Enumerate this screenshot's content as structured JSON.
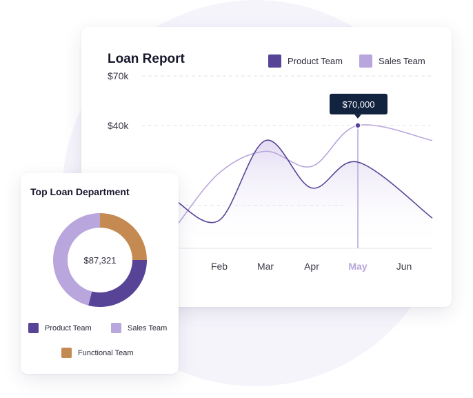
{
  "colors": {
    "product": "#584497",
    "sales": "#b9a6dc",
    "functional": "#c48a52",
    "tooltip_bg": "#12233f"
  },
  "report": {
    "title": "Loan Report",
    "legend": [
      {
        "label": "Product Team",
        "color": "#584497"
      },
      {
        "label": "Sales Team",
        "color": "#b9a6dc"
      }
    ],
    "tooltip": "$70,000",
    "active_month": "May"
  },
  "department": {
    "title": "Top Loan Department",
    "total": "$87,321",
    "legend": [
      {
        "label": "Product Team",
        "color": "#584497"
      },
      {
        "label": "Sales Team",
        "color": "#b9a6dc"
      },
      {
        "label": "Functional Team",
        "color": "#c48a52"
      }
    ]
  },
  "chart_data": [
    {
      "type": "line",
      "title": "Loan Report",
      "categories": [
        "Jan",
        "Feb",
        "Mar",
        "Apr",
        "May",
        "Jun"
      ],
      "visible_tick_labels": [
        "n",
        "Feb",
        "Mar",
        "Apr",
        "May",
        "Jun"
      ],
      "y_ticks": [
        {
          "value": 70000,
          "label": "$70k"
        },
        {
          "value": 40000,
          "label": "$40k"
        }
      ],
      "series": [
        {
          "name": "Product Team",
          "values": [
            22000,
            13000,
            50000,
            28000,
            40000,
            14000
          ]
        },
        {
          "name": "Sales Team",
          "values": [
            10000,
            35000,
            45000,
            38000,
            57000,
            50000
          ]
        }
      ],
      "highlight": {
        "category": "May",
        "value": 57000,
        "label": "$70,000"
      },
      "ylim": [
        0,
        80000
      ],
      "grid": true,
      "legend": "top-right"
    },
    {
      "type": "pie",
      "title": "Top Loan Department",
      "center_label": "$87,321",
      "labels": [
        "Functional Team",
        "Product Team",
        "Sales Team"
      ],
      "values": [
        25,
        29,
        46
      ],
      "legend": "bottom"
    }
  ]
}
